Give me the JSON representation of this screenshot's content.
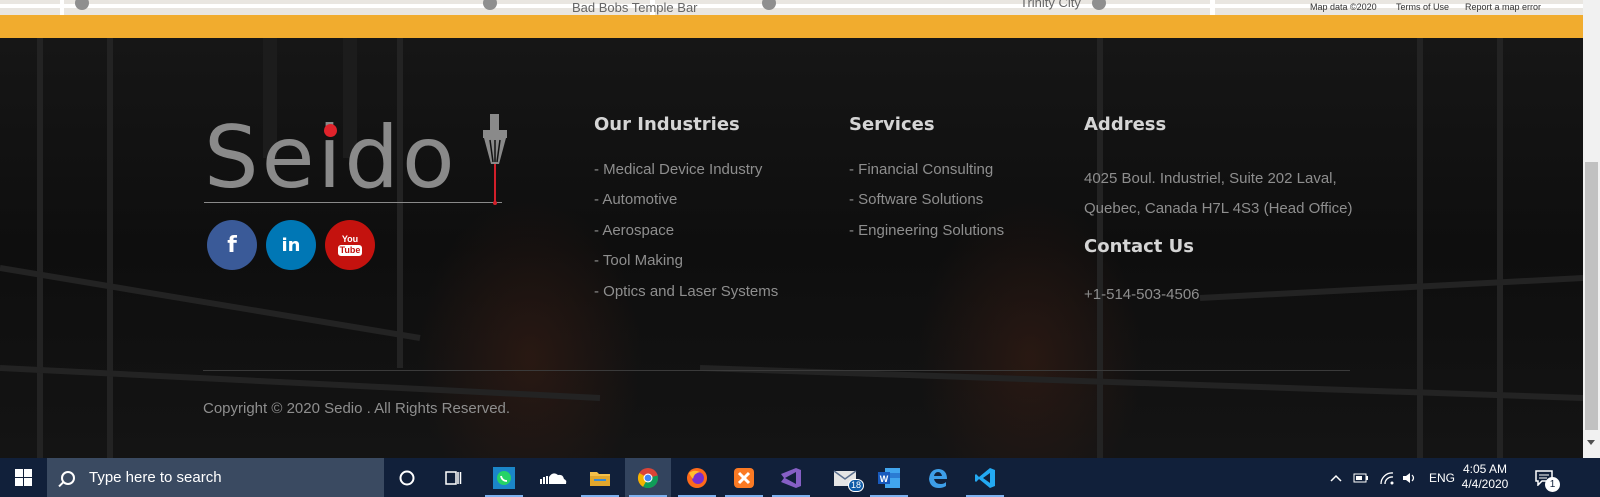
{
  "map": {
    "label_bar": "Bad Bobs Temple Bar",
    "label_city": "Trinity City",
    "attribution": [
      "Map data ©2020",
      "Terms of Use",
      "Report a map error"
    ]
  },
  "brand": {
    "logo_text": "Seido",
    "accent": "#f1ac2e",
    "logo_dot_color": "#e0232b"
  },
  "social": [
    {
      "name": "facebook",
      "glyph": "f",
      "color": "#3a5a98"
    },
    {
      "name": "linkedin",
      "glyph": "in",
      "color": "#0077b5"
    },
    {
      "name": "youtube",
      "glyph_top": "You",
      "glyph_bottom": "Tube",
      "color": "#c4120e"
    }
  ],
  "industries": {
    "title": "Our Industries",
    "items": [
      "- Medical Device Industry",
      "- Automotive",
      "- Aerospace",
      "- Tool Making",
      "- Optics and Laser Systems"
    ]
  },
  "services": {
    "title": "Services",
    "items": [
      "- Financial Consulting",
      "- Software Solutions",
      "- Engineering Solutions"
    ]
  },
  "address": {
    "title": "Address",
    "line1": "4025 Boul. Industriel, Suite 202 Laval,",
    "line2": "Quebec, Canada H7L 4S3 (Head Office)"
  },
  "contact": {
    "title": "Contact Us",
    "phone": "+1-514-503-4506"
  },
  "copyright": "Copyright © 2020 Sedio . All Rights Reserved.",
  "taskbar": {
    "search_placeholder": "Type here to search",
    "apps": [
      "task-view",
      "whatsapp",
      "soundcloud",
      "file-explorer",
      "chrome",
      "firefox",
      "xampp",
      "visual-studio",
      "mail",
      "word",
      "edge",
      "vscode"
    ],
    "mail_badge": "18",
    "language": "ENG",
    "time": "4:05 AM",
    "date": "4/4/2020",
    "notification_count": "1"
  }
}
